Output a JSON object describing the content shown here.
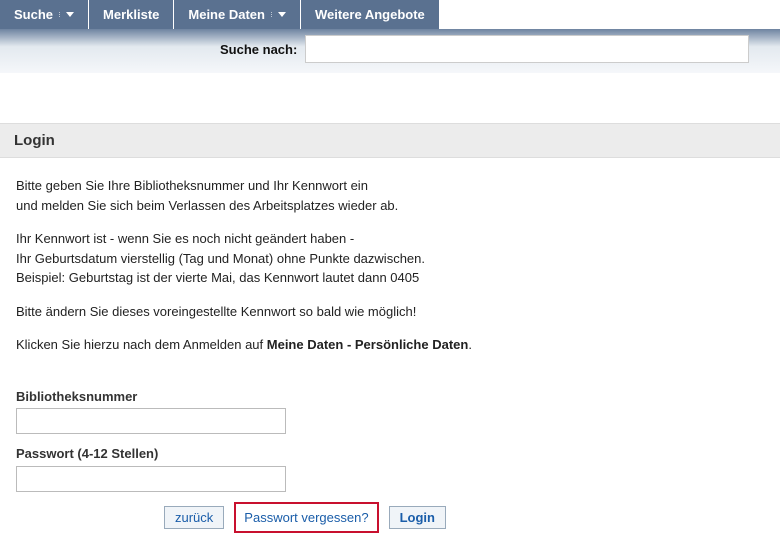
{
  "nav": {
    "search": "Suche",
    "merkliste": "Merkliste",
    "meine_daten": "Meine Daten",
    "weitere": "Weitere Angebote"
  },
  "searchbar": {
    "label": "Suche nach:",
    "value": ""
  },
  "section": {
    "title": "Login"
  },
  "instructions": {
    "p1a": "Bitte geben Sie Ihre Bibliotheksnummer und Ihr Kennwort ein",
    "p1b": "und melden Sie sich beim Verlassen des Arbeitsplatzes wieder ab.",
    "p2a": "Ihr Kennwort ist - wenn Sie es noch nicht geändert haben -",
    "p2b": "Ihr Geburtsdatum vierstellig (Tag und Monat) ohne Punkte dazwischen.",
    "p2c": "Beispiel: Geburtstag ist der vierte Mai, das Kennwort lautet dann 0405",
    "p3": "Bitte ändern Sie dieses voreingestellte Kennwort so bald wie möglich!",
    "p4a": "Klicken Sie hierzu nach dem Anmelden auf ",
    "p4b": "Meine Daten - Persönliche Daten",
    "p4c": "."
  },
  "form": {
    "libnum_label": "Bibliotheksnummer",
    "libnum_value": "",
    "pass_label": "Passwort (4-12 Stellen)",
    "pass_value": ""
  },
  "buttons": {
    "back": "zurück",
    "forgot": "Passwort vergessen?",
    "login": "Login"
  }
}
